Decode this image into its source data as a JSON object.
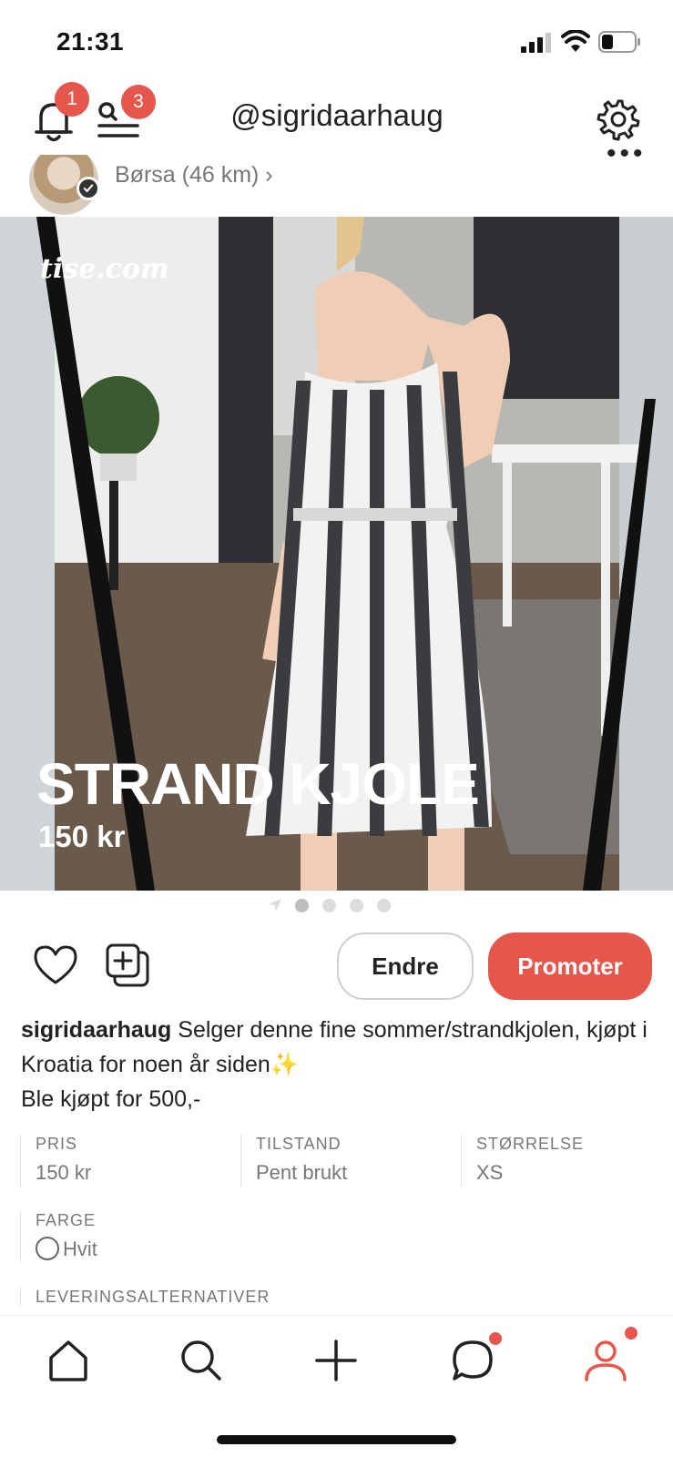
{
  "status_bar": {
    "time": "21:31"
  },
  "header": {
    "notification_count": "1",
    "search_count": "3",
    "handle": "@sigridaarhaug",
    "icons": [
      "bell-icon",
      "search-list-icon",
      "gear-icon",
      "more-icon"
    ]
  },
  "seller": {
    "location": "Børsa (46 km) ›"
  },
  "listing": {
    "watermark": "tise.com",
    "title": "STRAND KJOLE",
    "price_overlay": "150 kr",
    "image_pages": 4,
    "current_page": 1
  },
  "actions": {
    "edit_label": "Endre",
    "promote_label": "Promoter"
  },
  "description": {
    "user": "sigridaarhaug",
    "line1": " Selger denne fine sommer/strandkjolen, kjøpt i Kroatia for noen år siden✨",
    "line2": "Ble kjøpt for 500,-"
  },
  "details": {
    "price_label": "PRIS",
    "price_value": "150 kr",
    "condition_label": "TILSTAND",
    "condition_value": "Pent brukt",
    "size_label": "STØRRELSE",
    "size_value": "XS",
    "color_label": "FARGE",
    "color_value": "Hvit",
    "delivery_label": "LEVERINGSALTERNATIVER"
  },
  "colors": {
    "accent": "#e5564c",
    "text": "#222222",
    "muted": "#777777"
  },
  "bottom_nav": {
    "items": [
      "home-icon",
      "search-icon",
      "plus-icon",
      "chat-icon",
      "profile-icon"
    ]
  }
}
